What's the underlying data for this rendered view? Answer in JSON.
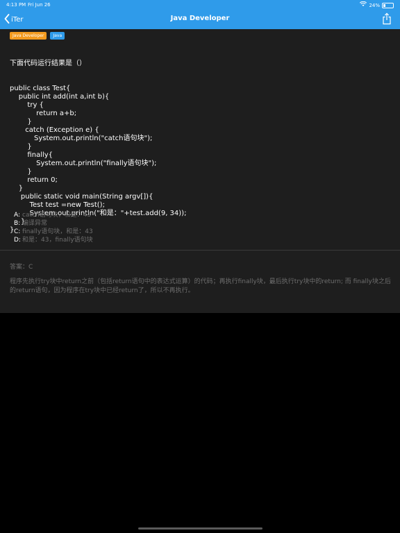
{
  "status_bar": {
    "time": "4:13 PM",
    "date": "Fri Jun 26",
    "battery": "24%",
    "battery_level": 0.24
  },
  "nav": {
    "back_label": "iTer",
    "title": "Java Developer"
  },
  "tags": [
    "Java Developer",
    "Java"
  ],
  "question": {
    "prompt": "下面代码运行结果是（）",
    "code_lines": [
      "public class Test{",
      "    public int add(int a,int b){",
      "        try {",
      "            return a+b;",
      "        }",
      "       catch (Exception e) {",
      "           System.out.println(\"catch语句块\");",
      "        }",
      "        finally{",
      "            System.out.println(\"finally语句块\");",
      "        }",
      "        return 0;",
      "    }",
      "     public static void main(String argv[]){",
      "         Test test =new Test();",
      "         System.out.println(\"和是：\"+test.add(9, 34));",
      "     }",
      "}"
    ]
  },
  "options": [
    {
      "label": "A:",
      "text": "catch语句块，和是：43"
    },
    {
      "label": "B:",
      "text": "编译异常"
    },
    {
      "label": "C:",
      "text": "finally语句块，和是：43"
    },
    {
      "label": "D:",
      "text": "和是：43，finally语句块"
    }
  ],
  "answer": "答案：C",
  "explanation": "程序先执行try块中return之前（包括return语句中的表达式运算）的代码；再执行finally块，最后执行try块中的return; 而 finally块之后的return语句，因为程序在try块中已经return了，所以不再执行。",
  "colors": {
    "accent": "#2f9bea",
    "tag_orange": "#f39a1e",
    "card_bg": "#1e1e1e",
    "muted_text": "#6e6e6e"
  }
}
